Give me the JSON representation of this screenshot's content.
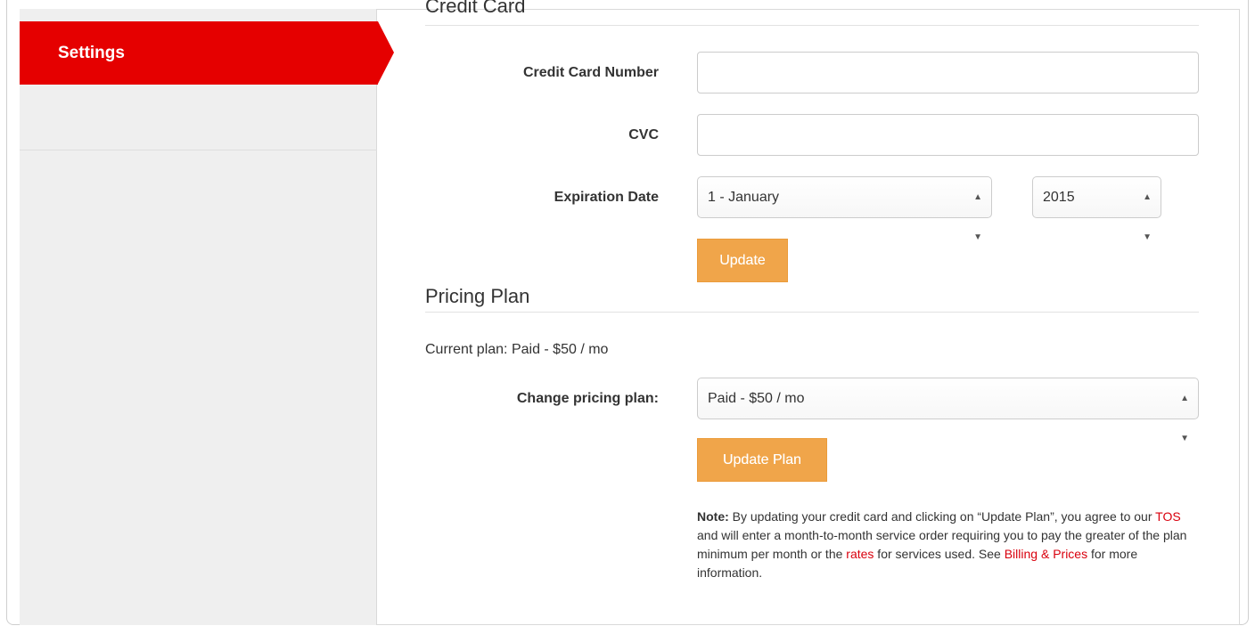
{
  "sidebar": {
    "active_item": "Settings"
  },
  "credit_card": {
    "section_title": "Credit Card",
    "card_number_label": "Credit Card Number",
    "card_number_value": "",
    "cvc_label": "CVC",
    "cvc_value": "",
    "expiration_label": "Expiration Date",
    "expiration_month": "1 - January",
    "expiration_year": "2015",
    "update_button": "Update"
  },
  "pricing": {
    "section_title": "Pricing Plan",
    "current_plan": "Current plan: Paid - $50 / mo",
    "change_label": "Change pricing plan:",
    "selected_plan": "Paid - $50 / mo",
    "update_button": "Update Plan"
  },
  "note": {
    "bold": "Note:",
    "text1": " By updating your credit card and clicking on “Update Plan”, you agree to our ",
    "tos_link": "TOS",
    "text2": " and will enter a month-to-month service order requiring you to pay the greater of the plan minimum per month or the ",
    "rates_link": "rates",
    "text3": " for services used. See ",
    "billing_link": "Billing & Prices",
    "text4": " for more information."
  },
  "colors": {
    "accent_red": "#e50000",
    "button_orange": "#f0a54a",
    "link_red": "#d9000d",
    "sidebar_bg": "#efefef"
  }
}
